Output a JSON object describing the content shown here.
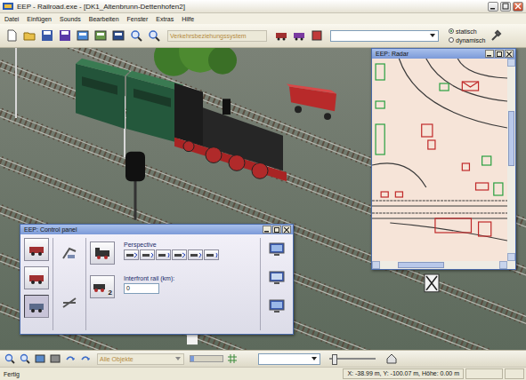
{
  "window": {
    "title": "EEP - Railroad.exe - [DK1_Altenbrunn-Dettenhofen2]"
  },
  "menu": [
    "Datei",
    "Einfügen",
    "Sounds",
    "Bearbeiten",
    "Fenster",
    "Extras",
    "Hilfe"
  ],
  "toolbar": {
    "system_dropdown": {
      "value": "Verkehrsbeziehungssystem",
      "disabled": true
    },
    "view_mode": [
      {
        "label": "statisch",
        "selected": true
      },
      {
        "label": "dynamisch",
        "selected": false
      }
    ]
  },
  "radar": {
    "title": "EEP: Radar"
  },
  "control_panel": {
    "title": "EEP: Control panel",
    "side_buttons": [
      {
        "selected": false
      },
      {
        "selected": false
      },
      {
        "selected": true
      }
    ],
    "perspective_label": "Perspective",
    "perspective_buttons": [
      {
        "selected": false
      },
      {
        "selected": false
      },
      {
        "selected": false
      },
      {
        "selected": false
      },
      {
        "selected": false
      },
      {
        "selected": false
      }
    ],
    "train_badge": "2",
    "field_label": "Interfront rail (km):",
    "field_value": "0"
  },
  "bottom_toolbar": {
    "object_dropdown": {
      "value": "Alle Objekte",
      "disabled": true
    },
    "slider_level": 0.1
  },
  "status_bar": {
    "left": "Fertig",
    "coords": "X: -38.99 m, Y: -100.07 m, Höhe: 0.00 m"
  }
}
